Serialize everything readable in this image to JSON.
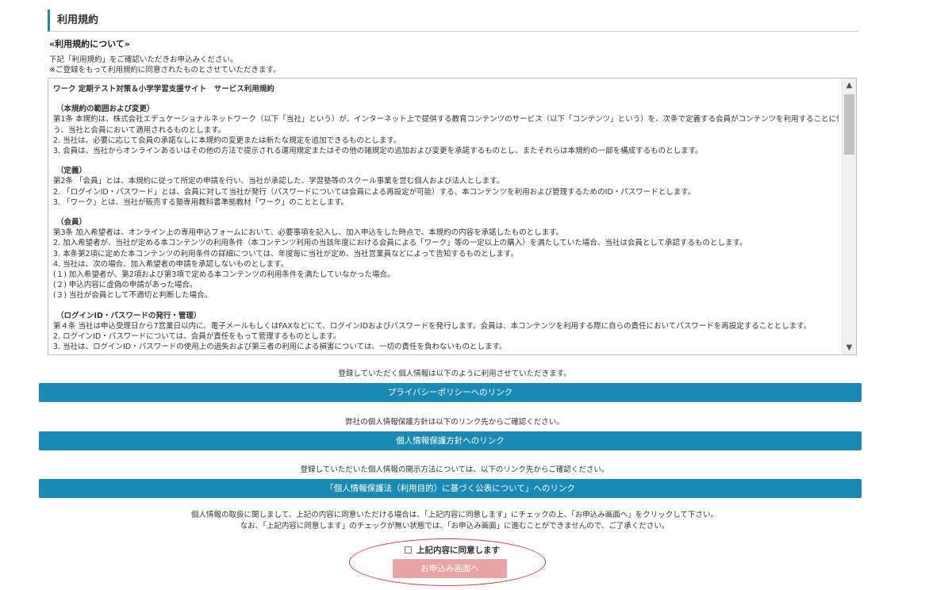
{
  "page": {
    "title": "利用規約",
    "subhead": "«利用規約について»",
    "intro": [
      "下記「利用規約」をご確認いただきお申込みください。",
      "※ご登録をもって利用規約に同意されたものとさせていただきます。"
    ]
  },
  "terms": {
    "doc_title": "ワーク 定期テスト対策＆小学学習支援サイト　サービス利用規約",
    "sections": [
      {
        "heading": "（本規約の範囲および変更）",
        "lines": [
          "第1条 本規約は、株式会社エデュケーショナルネットワーク（以下「当社」という）が、インターネット上で提供する教育コンテンツのサービス（以下「コンテンツ」という）を、次条で定義する会員がコンテンツを利用することに伴",
          "う、当社と会員において適用されるものとします。",
          "2. 当社は、必要に応じて会員の承諾なしに本規約の変更または新たな規定を追加できるものとします。",
          "3. 会員は、当社からオンラインあるいはその他の方法で提示される運用規定またはその他の諸規定の追加および変更を承諾するものとし、またそれらは本規約の一部を構成するものとします。"
        ]
      },
      {
        "heading": "（定義）",
        "lines": [
          "第2条 「会員」とは、本規約に従って所定の申請を行い、当社が承認した、学習塾等のスクール事業を営む個人および法人とします。",
          "2. 「ログインID・パスワード」とは、会員に対して当社が発行（パスワードについては会員による再設定が可能）する、本コンテンツを利用および管理するためのID・パスワードとします。",
          "3. 「ワーク」とは、当社が販売する塾専用教科書準拠教材「ワーク」のこととします。"
        ]
      },
      {
        "heading": "（会員）",
        "lines": [
          "第3条 加入希望者は、オンライン上の専用申込フォームにおいて、必要事項を記入し、加入申込をした時点で、本規約の内容を承諾したものとします。",
          "2. 加入希望者が、当社が定める本コンテンツの利用条件（本コンテンツ利用の当該年度における会員による「ワーク」等の一定以上の購入）を満たしていた場合、当社は会員として承認するものとします。",
          "3. 本条第2項に定めた本コンテンツの利用条件の詳細については、年度毎に当社が定め、当社営業員などによって告知するものとします。",
          "4. 当社は、次の場合、加入希望者の申請を承認しないものとします。",
          "(１) 加入希望者が、第2項および第3項で定める本コンテンツの利用条件を満たしていなかった場合。",
          "(２) 申込内容に虚偽の申請があった場合。",
          "(３) 当社が会員として不適切と判断した場合。"
        ]
      },
      {
        "heading": "（ログインID・パスワードの発行・管理）",
        "lines": [
          "第４条 当社は申込受理日から7営業日以内に、電子メールもしくはFAXなどにて、ログインIDおよびパスワードを発行します。会員は、本コンテンツを利用する際に自らの責任においてパスワードを再設定することとします。",
          "2. ログインID・パスワードについては、会員が責任をもって管理するものとします。",
          "3. 当社は、ログインID・パスワードの使用上の過失および第三者の利用による損害については、一切の責任を負わないものとします。"
        ]
      }
    ]
  },
  "notices": {
    "privacy_policy": "登録していただく個人情報は以下のように利用させていただきます。",
    "protection_policy": "弊社の個人情報保護方針は以下のリンク先からご確認ください。",
    "disclosure": "登録していただいた個人情報の開示方法については、以下のリンク先からご確認ください。"
  },
  "links": {
    "privacy_policy": "プライバシーポリシーへのリンク",
    "protection_policy": "個人情報保護方針へのリンク",
    "public_notice": "「個人情報保護法（利用目的）に基づく公表について」へのリンク"
  },
  "agreement": {
    "text_line1": "個人情報の取扱に関しまして、上記の内容に同意いただける場合は、「上記内容に同意します」にチェックの上、「お申込み画面へ」をクリックして下さい。",
    "text_line2": "なお、「上記内容に同意します」のチェックが無い状態では、「お申込み画面」に進むことができませんので、ご了承ください。",
    "checkbox_label": "上記内容に同意します",
    "checked": false,
    "submit_label": "お申込み画面へ"
  },
  "colors": {
    "accent": "#1a8ab5",
    "submit_disabled": "#e8a4a4",
    "highlight": "#d9364a"
  }
}
